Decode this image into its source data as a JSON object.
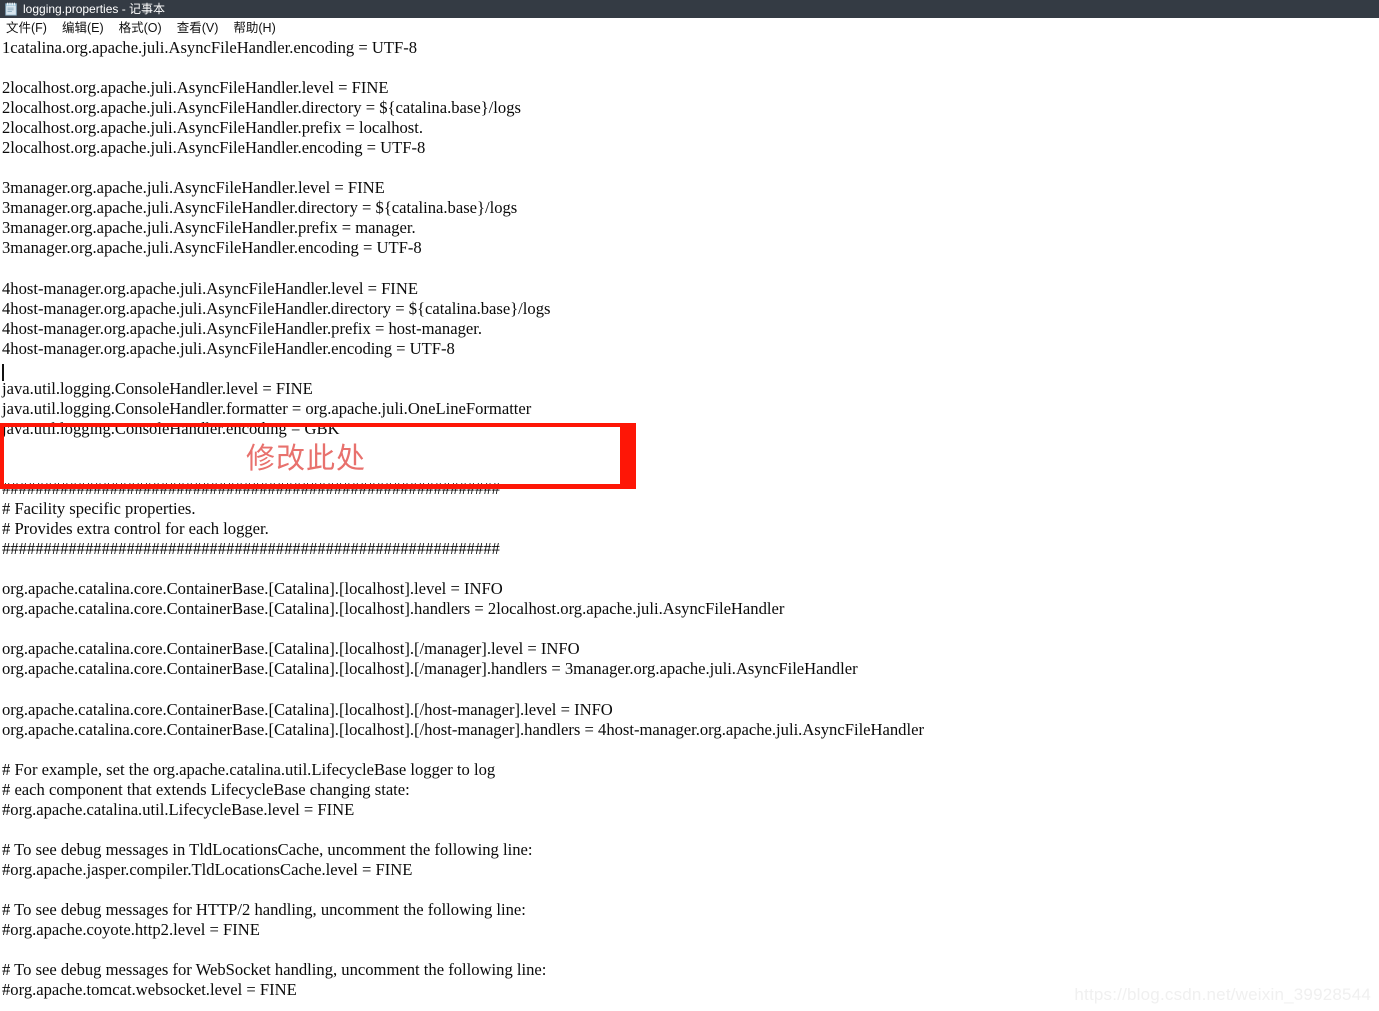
{
  "window": {
    "title": "logging.properties - 记事本",
    "icon": "notepad-icon",
    "titlebar_color": "#343b44"
  },
  "menubar": {
    "items": [
      {
        "label": "文件(F)"
      },
      {
        "label": "编辑(E)"
      },
      {
        "label": "格式(O)"
      },
      {
        "label": "查看(V)"
      },
      {
        "label": "帮助(H)"
      }
    ]
  },
  "annotation": {
    "text": "修改此处",
    "box_color": "#fe1606",
    "text_color": "#e8716d"
  },
  "watermark": {
    "text": "https://blog.csdn.net/weixin_39928544",
    "color": "#f0f0f0"
  },
  "editor": {
    "font": "serif-monospaced",
    "lines": [
      "1catalina.org.apache.juli.AsyncFileHandler.encoding = UTF-8",
      "",
      "2localhost.org.apache.juli.AsyncFileHandler.level = FINE",
      "2localhost.org.apache.juli.AsyncFileHandler.directory = ${catalina.base}/logs",
      "2localhost.org.apache.juli.AsyncFileHandler.prefix = localhost.",
      "2localhost.org.apache.juli.AsyncFileHandler.encoding = UTF-8",
      "",
      "3manager.org.apache.juli.AsyncFileHandler.level = FINE",
      "3manager.org.apache.juli.AsyncFileHandler.directory = ${catalina.base}/logs",
      "3manager.org.apache.juli.AsyncFileHandler.prefix = manager.",
      "3manager.org.apache.juli.AsyncFileHandler.encoding = UTF-8",
      "",
      "4host-manager.org.apache.juli.AsyncFileHandler.level = FINE",
      "4host-manager.org.apache.juli.AsyncFileHandler.directory = ${catalina.base}/logs",
      "4host-manager.org.apache.juli.AsyncFileHandler.prefix = host-manager.",
      "4host-manager.org.apache.juli.AsyncFileHandler.encoding = UTF-8",
      "",
      "java.util.logging.ConsoleHandler.level = FINE",
      "java.util.logging.ConsoleHandler.formatter = org.apache.juli.OneLineFormatter",
      "java.util.logging.ConsoleHandler.encoding = GBK",
      "",
      "",
      "############################################################",
      "# Facility specific properties.",
      "# Provides extra control for each logger.",
      "############################################################",
      "",
      "org.apache.catalina.core.ContainerBase.[Catalina].[localhost].level = INFO",
      "org.apache.catalina.core.ContainerBase.[Catalina].[localhost].handlers = 2localhost.org.apache.juli.AsyncFileHandler",
      "",
      "org.apache.catalina.core.ContainerBase.[Catalina].[localhost].[/manager].level = INFO",
      "org.apache.catalina.core.ContainerBase.[Catalina].[localhost].[/manager].handlers = 3manager.org.apache.juli.AsyncFileHandler",
      "",
      "org.apache.catalina.core.ContainerBase.[Catalina].[localhost].[/host-manager].level = INFO",
      "org.apache.catalina.core.ContainerBase.[Catalina].[localhost].[/host-manager].handlers = 4host-manager.org.apache.juli.AsyncFileHandler",
      "",
      "# For example, set the org.apache.catalina.util.LifecycleBase logger to log",
      "# each component that extends LifecycleBase changing state:",
      "#org.apache.catalina.util.LifecycleBase.level = FINE",
      "",
      "# To see debug messages in TldLocationsCache, uncomment the following line:",
      "#org.apache.jasper.compiler.TldLocationsCache.level = FINE",
      "",
      "# To see debug messages for HTTP/2 handling, uncomment the following line:",
      "#org.apache.coyote.http2.level = FINE",
      "",
      "# To see debug messages for WebSocket handling, uncomment the following line:",
      "#org.apache.tomcat.websocket.level = FINE"
    ]
  }
}
